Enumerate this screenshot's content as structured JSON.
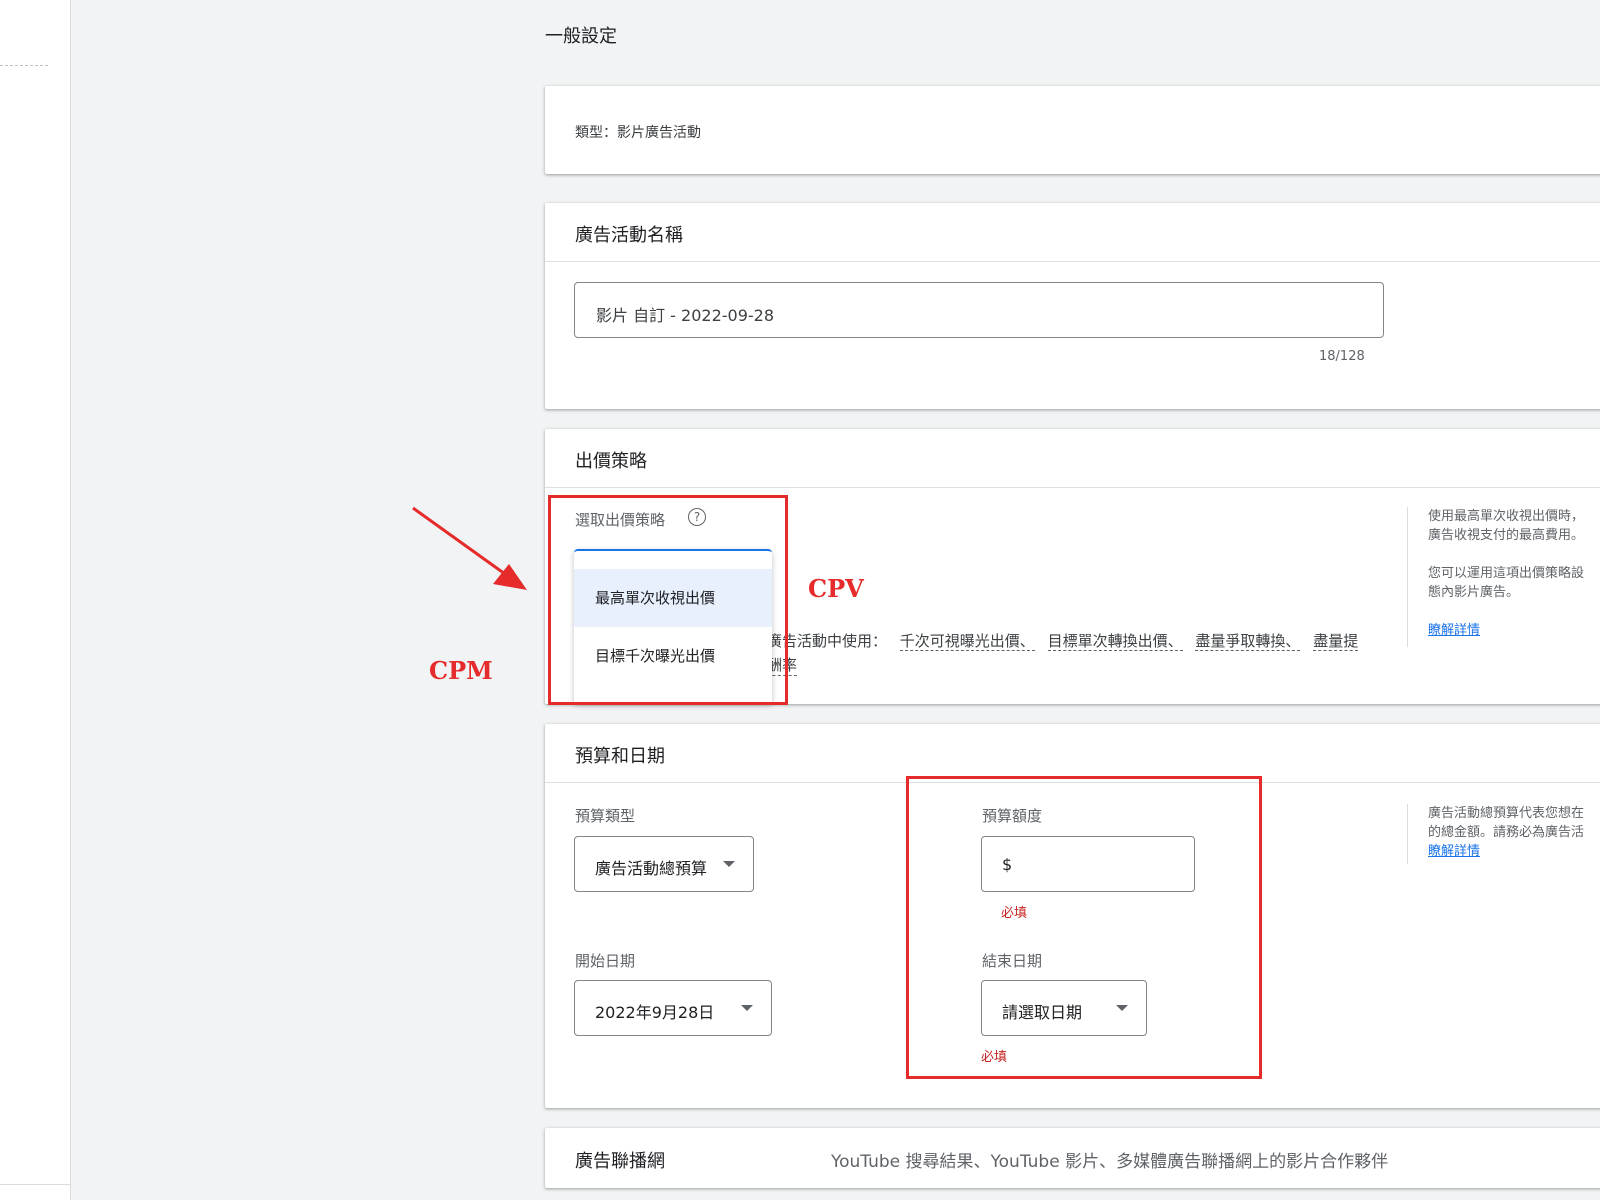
{
  "page": {
    "section_title": "一般設定"
  },
  "type_card": {
    "text": "類型：影片廣告活動"
  },
  "name_card": {
    "title": "廣告活動名稱",
    "input_value": "影片 自訂 - 2022-09-28",
    "counter": "18/128"
  },
  "bid_card": {
    "title": "出價策略",
    "select_label": "選取出價策略",
    "help_icon": "?",
    "options": [
      "最高單次收視出價",
      "目標千次曝光出價"
    ],
    "selected_index": 0,
    "usage_prefix": "廣告活動中使用：",
    "usage_items": [
      "千次可視曝光出價、",
      "目標單次轉換出價、",
      "盡量爭取轉換、",
      "盡量提"
    ],
    "usage_tail": "酬率",
    "side_line1": "使用最高單次收視出價時，",
    "side_line2": "廣告收視支付的最高費用。",
    "side_line3": "您可以運用這項出價策略設",
    "side_line4": "態內影片廣告。",
    "learn_more": "瞭解詳情"
  },
  "budget_card": {
    "title": "預算和日期",
    "budget_type_label": "預算類型",
    "budget_type_value": "廣告活動總預算",
    "budget_amount_label": "預算額度",
    "budget_amount_prefix": "$",
    "required_1": "必填",
    "start_label": "開始日期",
    "start_value": "2022年9月28日",
    "end_label": "結束日期",
    "end_value": "請選取日期",
    "required_2": "必填",
    "side_line1": "廣告活動總預算代表您想在",
    "side_line2": "的總金額。請務必為廣告活",
    "learn_more": "瞭解詳情"
  },
  "network_card": {
    "title": "廣告聯播網",
    "description": "YouTube 搜尋結果、YouTube 影片、多媒體廣告聯播網上的影片合作夥伴"
  },
  "annotations": {
    "cpv": "CPV",
    "cpm": "CPM",
    "color": "#e52b2b"
  },
  "colors": {
    "accent": "#1a73e8",
    "selected_bg": "#e8f0fe",
    "error": "#c5221f"
  }
}
